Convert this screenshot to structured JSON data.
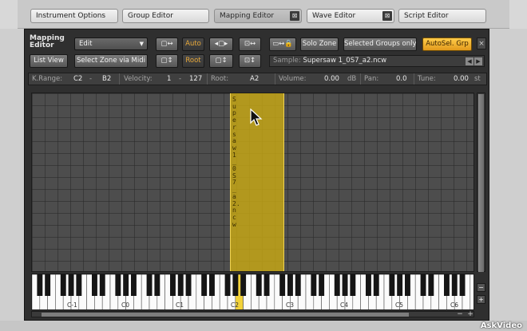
{
  "tabs": [
    {
      "label": "Instrument Options",
      "close": false,
      "active": false
    },
    {
      "label": "Group Editor",
      "close": false,
      "active": false
    },
    {
      "label": "Mapping Editor",
      "close": true,
      "active": true
    },
    {
      "label": "Wave Editor",
      "close": true,
      "active": false
    },
    {
      "label": "Script Editor",
      "close": false,
      "active": false
    }
  ],
  "editor": {
    "title_line1": "Mapping",
    "title_line2": "Editor",
    "mode": "Edit",
    "list_view": "List View",
    "select_zone_midi": "Select Zone via Midi",
    "auto": "Auto",
    "root": "Root",
    "solo_zone": "Solo Zone",
    "selected_groups_only": "Selected Groups only",
    "autosel_grp": "AutoSel. Grp",
    "close": "×"
  },
  "sample": {
    "label": "Sample:",
    "value": "Supersaw 1_0S7_a2.ncw"
  },
  "params": {
    "krange_label": "K.Range:",
    "krange_low": "C2",
    "krange_dash": "-",
    "krange_high": "B2",
    "velocity_label": "Velocity:",
    "vel_low": "1",
    "vel_dash": "-",
    "vel_high": "127",
    "root_label": "Root:",
    "root_value": "A2",
    "volume_label": "Volume:",
    "volume_value": "0.00",
    "volume_unit": "dB",
    "pan_label": "Pan:",
    "pan_value": "0.0",
    "tune_label": "Tune:",
    "tune_value": "0.00",
    "tune_unit": "st"
  },
  "zone": {
    "name": "Supersaw 1_0S7_a2.ncw",
    "root_key": "A2"
  },
  "keyboard": {
    "octaves": [
      "C-1",
      "C0",
      "C1",
      "C2",
      "C3",
      "C4",
      "C5",
      "C6"
    ]
  },
  "colors": {
    "zone": "#c8a814",
    "accent": "#f0a020",
    "panel": "#2f2f2f"
  },
  "watermark": "AskVideo"
}
